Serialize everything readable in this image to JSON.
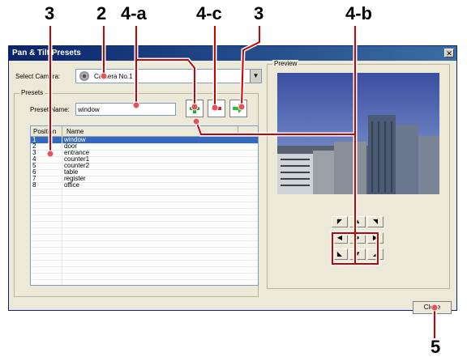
{
  "callouts": {
    "c3_left": "3",
    "c2": "2",
    "c4a": "4-a",
    "c4c": "4-c",
    "c3_right": "3",
    "c4b": "4-b",
    "c5": "5"
  },
  "window": {
    "title": "Pan & Tilt Presets",
    "close_glyph": "✕"
  },
  "camera": {
    "label": "Select Camera:",
    "selected": "Camera No.1"
  },
  "presets": {
    "group_title": "Presets",
    "name_label": "Preset Name:",
    "name_value": "window",
    "columns": [
      "Position",
      "Name"
    ],
    "rows": [
      {
        "position": "1",
        "name": "window"
      },
      {
        "position": "2",
        "name": "door"
      },
      {
        "position": "3",
        "name": "entrance"
      },
      {
        "position": "4",
        "name": "counter1"
      },
      {
        "position": "5",
        "name": "counter2"
      },
      {
        "position": "6",
        "name": "table"
      },
      {
        "position": "7",
        "name": "register"
      },
      {
        "position": "8",
        "name": "office"
      }
    ],
    "selected_index": 0
  },
  "preview": {
    "group_title": "Preview"
  },
  "ptz_buttons": {
    "up_left": "◤",
    "up": "▲",
    "up_right": "◥",
    "left": "◀",
    "home": "●",
    "right": "▶",
    "down_left": "◣",
    "down": "▼",
    "down_right": "◢"
  },
  "footer": {
    "close_label": "Close"
  },
  "colors": {
    "callout_line": "#cc0000",
    "callout_dot": "#e8505b",
    "title_bar": "#0a246a",
    "selection": "#316ac5",
    "add_icon": "#22aa22",
    "remove_icon": "#cc2222",
    "move_icon": "#33bb33"
  }
}
